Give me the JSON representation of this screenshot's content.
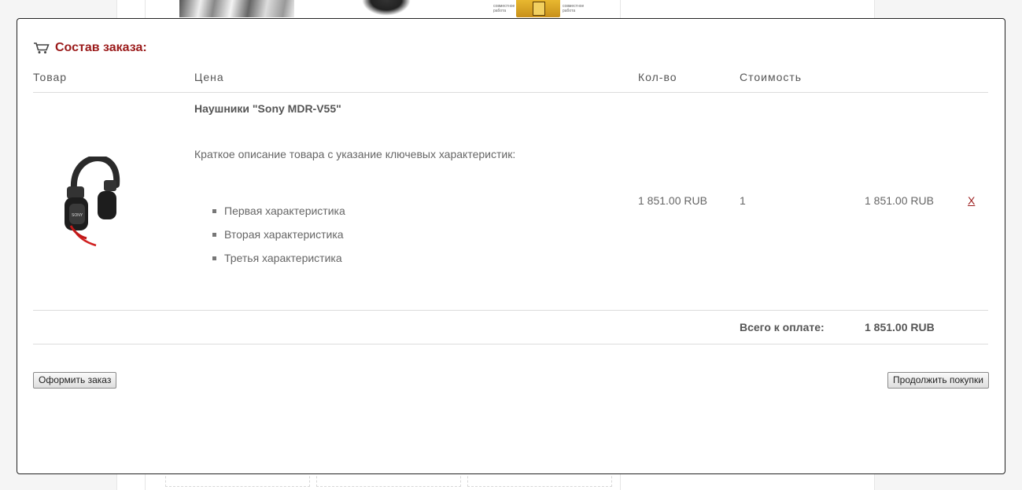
{
  "background": {
    "badge_text_left": "совместное работа",
    "badge_text_right": "совместное работа"
  },
  "order": {
    "title": "Состав заказа:",
    "columns": {
      "product": "Товар",
      "price": "Цена",
      "qty": "Кол-во",
      "cost": "Стоимость"
    },
    "item": {
      "name": "Наушники \"Sony MDR-V55\"",
      "description": "Краткое описание товара с указание ключевых характеристик:",
      "features": [
        "Первая характеристика",
        "Вторая характеристика",
        "Третья характеристика"
      ],
      "price": "1 851.00 RUB",
      "qty": "1",
      "cost": "1 851.00 RUB",
      "remove_label": "X"
    },
    "total_label": "Всего к оплате:",
    "total_value": "1 851.00 RUB",
    "checkout_label": "Оформить заказ",
    "continue_label": "Продолжить покупки"
  }
}
